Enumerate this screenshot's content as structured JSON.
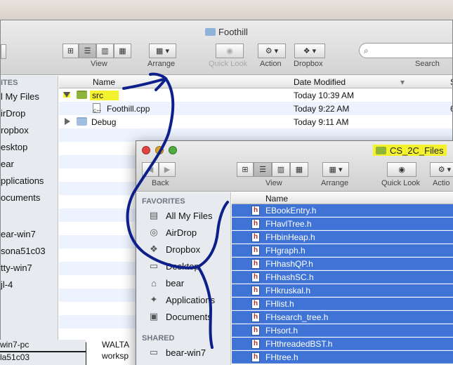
{
  "back_window": {
    "title": "Foothill",
    "toolbar": {
      "view_label": "View",
      "arrange_label": "Arrange",
      "quicklook_label": "Quick Look",
      "action_label": "Action",
      "dropbox_label": "Dropbox",
      "search_label": "Search"
    },
    "sidebar": {
      "header": "ITES",
      "items": [
        "l My Files",
        "irDrop",
        "ropbox",
        "esktop",
        "ear",
        "pplications",
        "ocuments",
        "ear-win7",
        "sona51c03",
        "tty-win7",
        "jl-4",
        "win7-pc",
        "la51c03"
      ]
    },
    "columns": {
      "name": "Name",
      "date": "Date Modified",
      "size": "S"
    },
    "rows": [
      {
        "name": "src",
        "date": "Today 10:39 AM",
        "extra": ""
      },
      {
        "name": "Foothill.cpp",
        "date": "Today 9:22 AM",
        "extra": "6"
      },
      {
        "name": "Debug",
        "date": "Today 9:11 AM",
        "extra": ""
      }
    ],
    "bottom_items": [
      "WALTA",
      "worksp"
    ]
  },
  "front_window": {
    "title": "CS_2C_Files",
    "toolbar": {
      "back_label": "Back",
      "view_label": "View",
      "arrange_label": "Arrange",
      "quicklook_label": "Quick Look",
      "action_label": "Actio"
    },
    "sidebar": {
      "favorites_header": "FAVORITES",
      "favorites": [
        {
          "label": "All My Files",
          "icon": "all-files-icon"
        },
        {
          "label": "AirDrop",
          "icon": "airdrop-icon"
        },
        {
          "label": "Dropbox",
          "icon": "dropbox-icon"
        },
        {
          "label": "Desktop",
          "icon": "desktop-icon"
        },
        {
          "label": "bear",
          "icon": "home-icon"
        },
        {
          "label": "Applications",
          "icon": "applications-icon"
        },
        {
          "label": "Documents",
          "icon": "documents-icon"
        }
      ],
      "shared_header": "SHARED",
      "shared": [
        {
          "label": "bear-win7",
          "icon": "network-computer-icon"
        }
      ]
    },
    "column_name": "Name",
    "files": [
      "EBookEntry.h",
      "FHavlTree.h",
      "FHbinHeap.h",
      "FHgraph.h",
      "FHhashQP.h",
      "FHhashSC.h",
      "FHkruskal.h",
      "FHlist.h",
      "FHsearch_tree.h",
      "FHsort.h",
      "FHthreadedBST.h",
      "FHtree.h"
    ]
  },
  "colors": {
    "highlight": "#f4f22d",
    "selection": "#3f74d6",
    "annotation_ink": "#0c1f8a"
  }
}
